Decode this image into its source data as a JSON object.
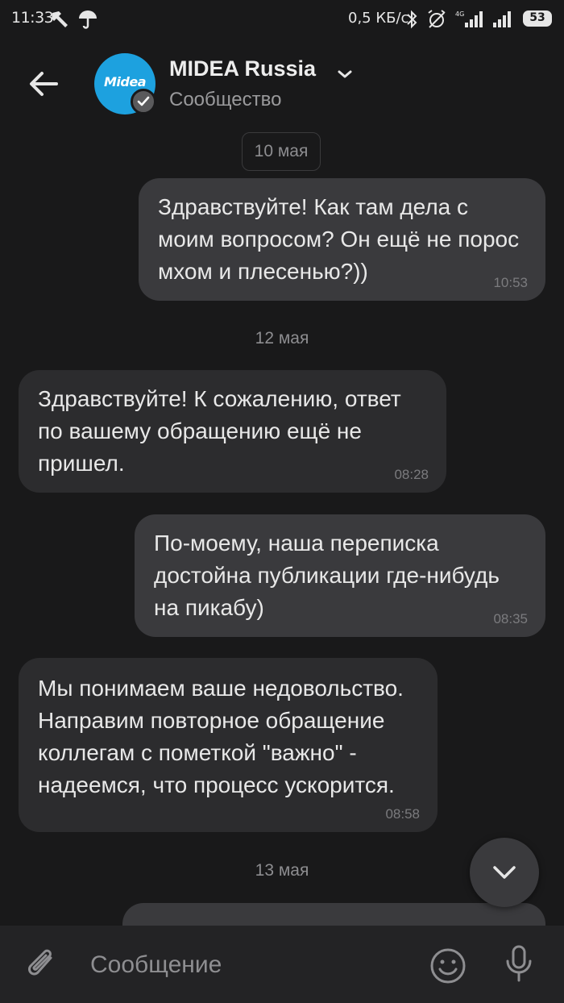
{
  "status_bar": {
    "time": "11:33",
    "speed": "0,5 КБ/с",
    "network": "4G",
    "battery": "53"
  },
  "header": {
    "channel_name": "MIDEA Russia",
    "channel_subtitle": "Сообщество",
    "avatar_logo_text": "Midea"
  },
  "chat": {
    "dates": [
      "10 мая",
      "12 мая",
      "13 мая"
    ],
    "messages": [
      {
        "direction": "out",
        "text": "Здравствуйте! Как там дела с\nмоим вопросом? Он ещё не порос\nмхом и плесенью?))",
        "time": "10:53"
      },
      {
        "direction": "in",
        "text": "Здравствуйте! К сожалению, ответ\nпо вашему обращению ещё не\nпришел.",
        "time": "08:28"
      },
      {
        "direction": "out",
        "text": "По-моему, наша переписка\nдостойна публикации где-нибудь\nна пикабу)",
        "time": "08:35"
      },
      {
        "direction": "in",
        "text": "Мы понимаем ваше недовольство.\nНаправим повторное обращение\nколлегам с пометкой \"важно\" -\nнадеемся, что процесс ускорится.",
        "time": "08:58"
      }
    ]
  },
  "composer": {
    "placeholder": "Сообщение"
  },
  "colors": {
    "background": "#19191a",
    "bubble_outgoing": "#3a3a3d",
    "bubble_incoming": "#2c2c2e",
    "avatar_blue": "#1da1df"
  },
  "icons": {
    "back": "arrow-left-icon",
    "verified": "check-icon",
    "chevron": "chevron-down-icon",
    "scroll_down": "chevron-down-icon",
    "attach": "paperclip-icon",
    "emoji": "smiley-icon",
    "mic": "microphone-icon"
  }
}
